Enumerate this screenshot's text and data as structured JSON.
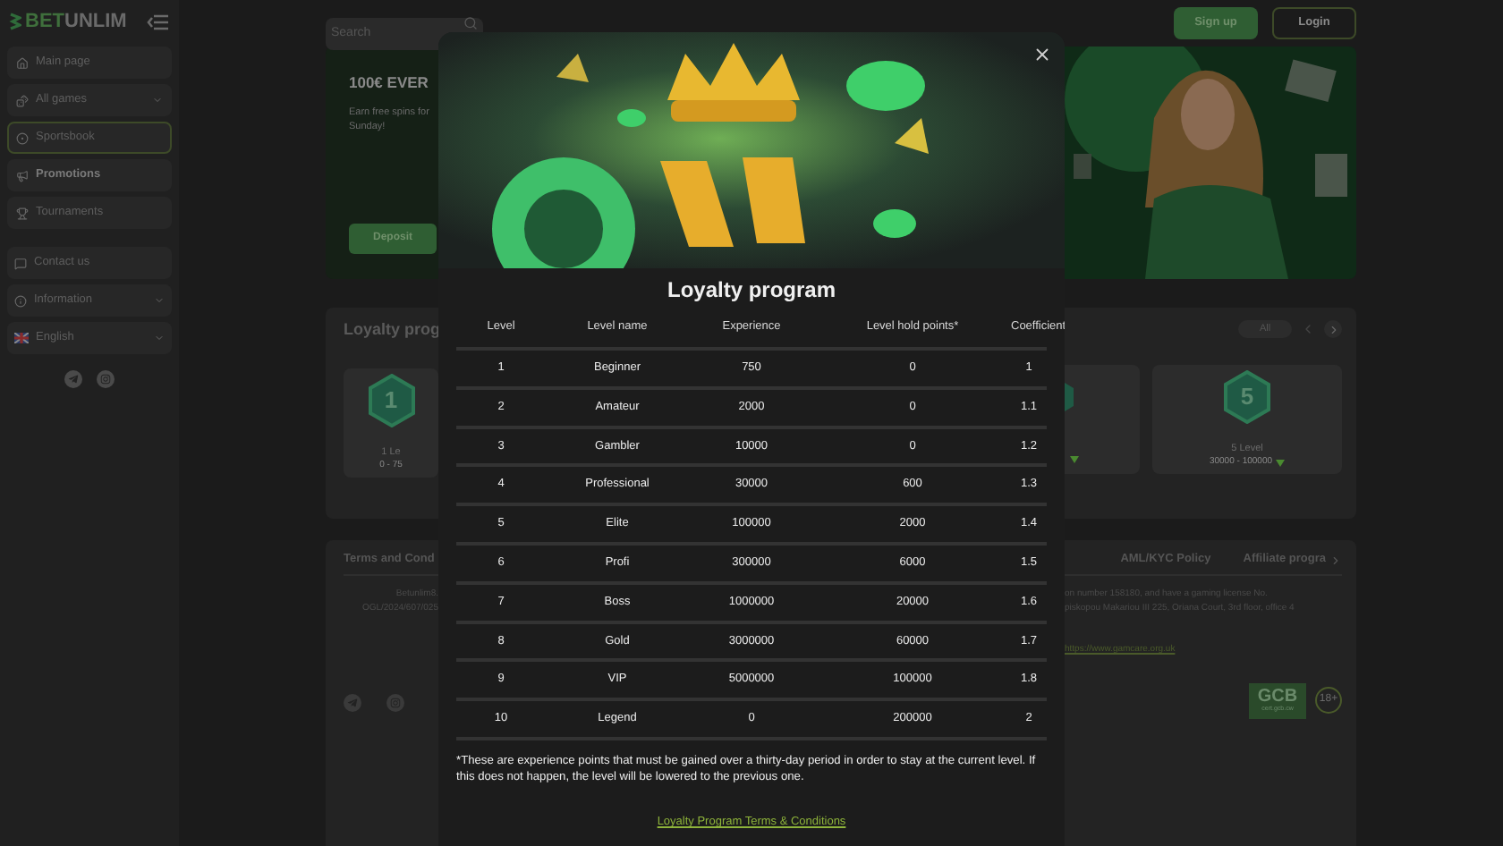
{
  "sidebar": {
    "logo": {
      "prefix": "BET",
      "suffix": "UNLIM"
    },
    "nav": [
      {
        "label": "Main page",
        "expandable": false,
        "outlined": false,
        "selected": false
      },
      {
        "label": "All games",
        "expandable": true,
        "outlined": false,
        "selected": false
      },
      {
        "label": "Sportsbook",
        "expandable": false,
        "outlined": true,
        "selected": false
      },
      {
        "label": "Promotions",
        "expandable": false,
        "outlined": false,
        "selected": true
      },
      {
        "label": "Tournaments",
        "expandable": false,
        "outlined": false,
        "selected": false
      }
    ],
    "extra": [
      {
        "label": "Contact us",
        "expandable": false
      },
      {
        "label": "Information",
        "expandable": true
      },
      {
        "label": "English",
        "expandable": true
      }
    ]
  },
  "header": {
    "search": {
      "placeholder": "Search"
    },
    "buttons": [
      {
        "label": "Sign up",
        "kind": "primary"
      },
      {
        "label": "Login",
        "kind": "outline"
      }
    ]
  },
  "banner": {
    "title": "100€ EVER",
    "lines": [
      "Earn free spins for",
      "Sunday!"
    ],
    "button": "Deposit"
  },
  "loyalty_section": {
    "title": "Loyalty prog",
    "filter": "All",
    "cards": [
      {
        "badge": "1",
        "title": "1 Le",
        "range": "0 - 75"
      },
      {
        "badge": "5",
        "title": "5 Level",
        "range": "30000 - 100000"
      }
    ]
  },
  "footer": {
    "links": [
      "Terms and Cond",
      "AML/KYC Policy",
      "Affiliate progra"
    ],
    "left_text": [
      "Betunlim8.",
      "OGL/2024/607/025"
    ],
    "right_text": [
      "on number 158180, and have a gaming license No.",
      "piskopou Makariou III 225, Oriana Court, 3rd floor, office 4"
    ],
    "link": "https://www.gamcare.org.uk",
    "seal": {
      "title": "GCB",
      "subtitle": "cert.gcb.cw"
    },
    "age": "18+"
  },
  "modal": {
    "title": "Loyalty program",
    "columns": [
      "Level",
      "Level name",
      "Experience",
      "Level hold points*",
      "Coefficient"
    ],
    "rows": [
      [
        "1",
        "Beginner",
        "750",
        "0",
        "1"
      ],
      [
        "2",
        "Amateur",
        "2000",
        "0",
        "1.1"
      ],
      [
        "3",
        "Gambler",
        "10000",
        "0",
        "1.2"
      ],
      [
        "4",
        "Professional",
        "30000",
        "600",
        "1.3"
      ],
      [
        "5",
        "Elite",
        "100000",
        "2000",
        "1.4"
      ],
      [
        "6",
        "Profi",
        "300000",
        "6000",
        "1.5"
      ],
      [
        "7",
        "Boss",
        "1000000",
        "20000",
        "1.6"
      ],
      [
        "8",
        "Gold",
        "3000000",
        "60000",
        "1.7"
      ],
      [
        "9",
        "VIP",
        "5000000",
        "100000",
        "1.8"
      ],
      [
        "10",
        "Legend",
        "0",
        "200000",
        "2"
      ]
    ],
    "footnote": "*These are experience points that must be gained over a thirty-day period in order to stay at the current level. If this does not happen, the level will be lowered to the previous one.",
    "link": "Loyalty Program Terms & Conditions"
  }
}
